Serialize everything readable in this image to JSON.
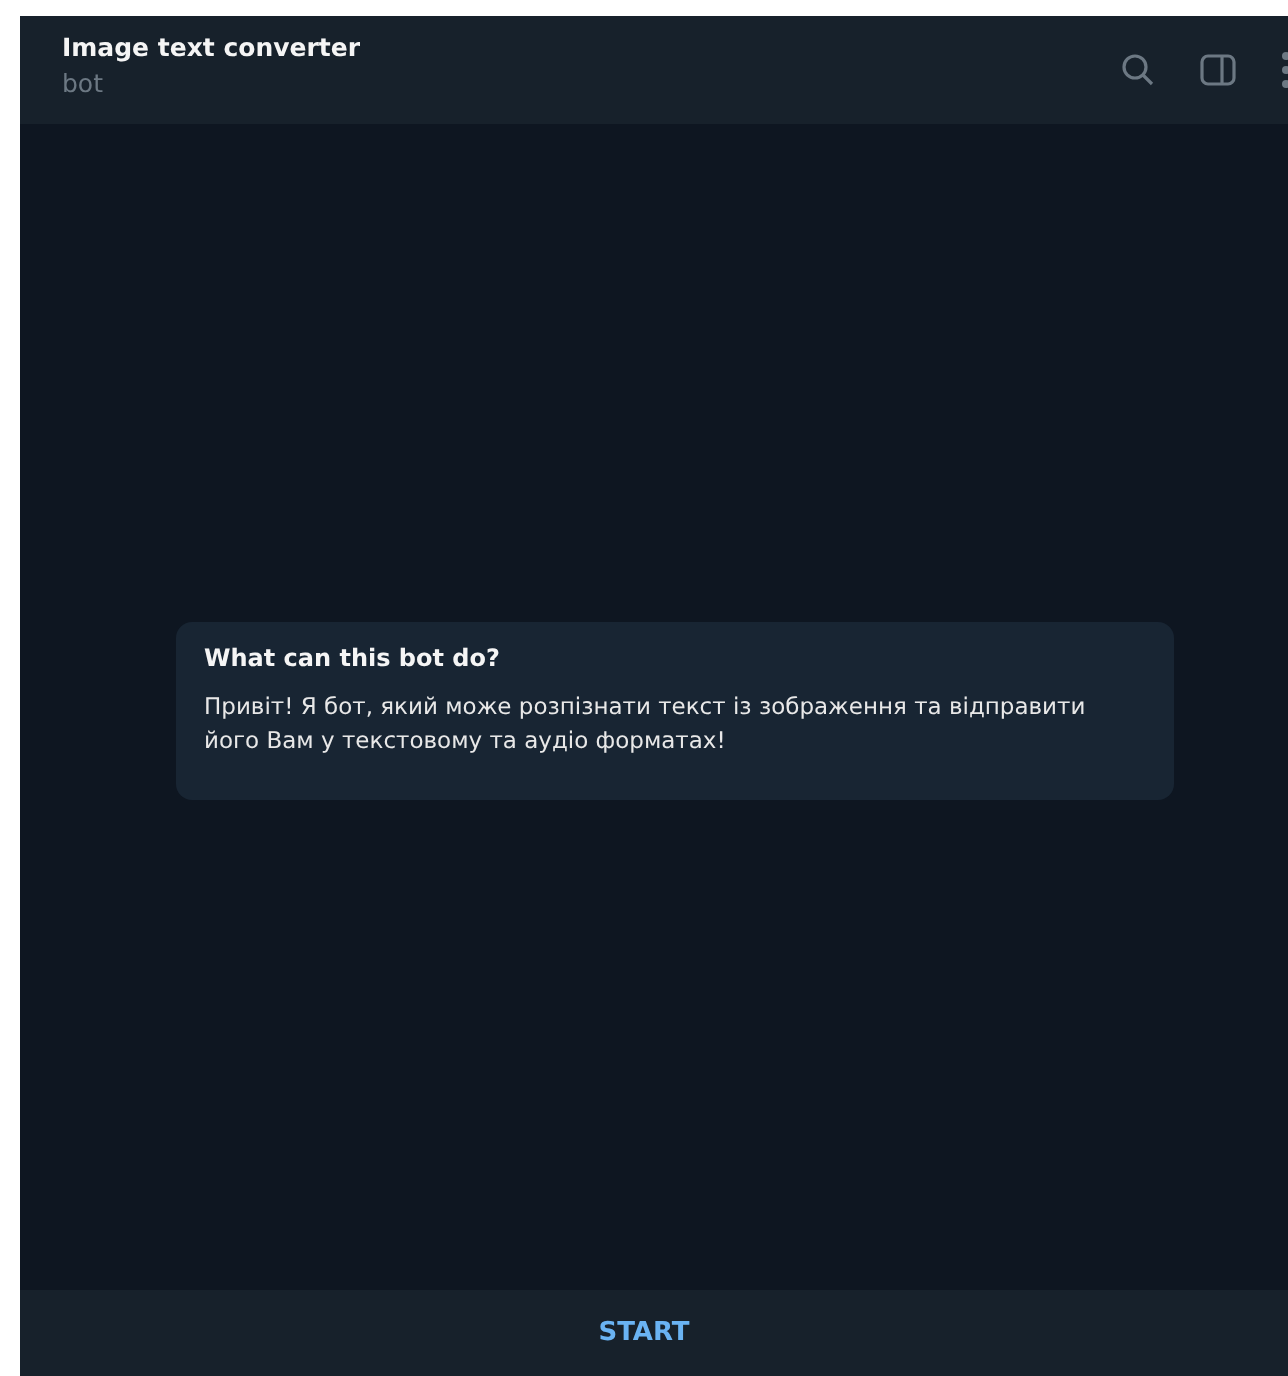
{
  "header": {
    "title": "Image text converter",
    "subtitle": "bot"
  },
  "info_card": {
    "title": "What can this bot do?",
    "text": "Привіт! Я бот, який може розпізнати текст із зображення та відправити його Вам у текстовому та аудіо форматах!"
  },
  "bottom_bar": {
    "button": "START"
  }
}
